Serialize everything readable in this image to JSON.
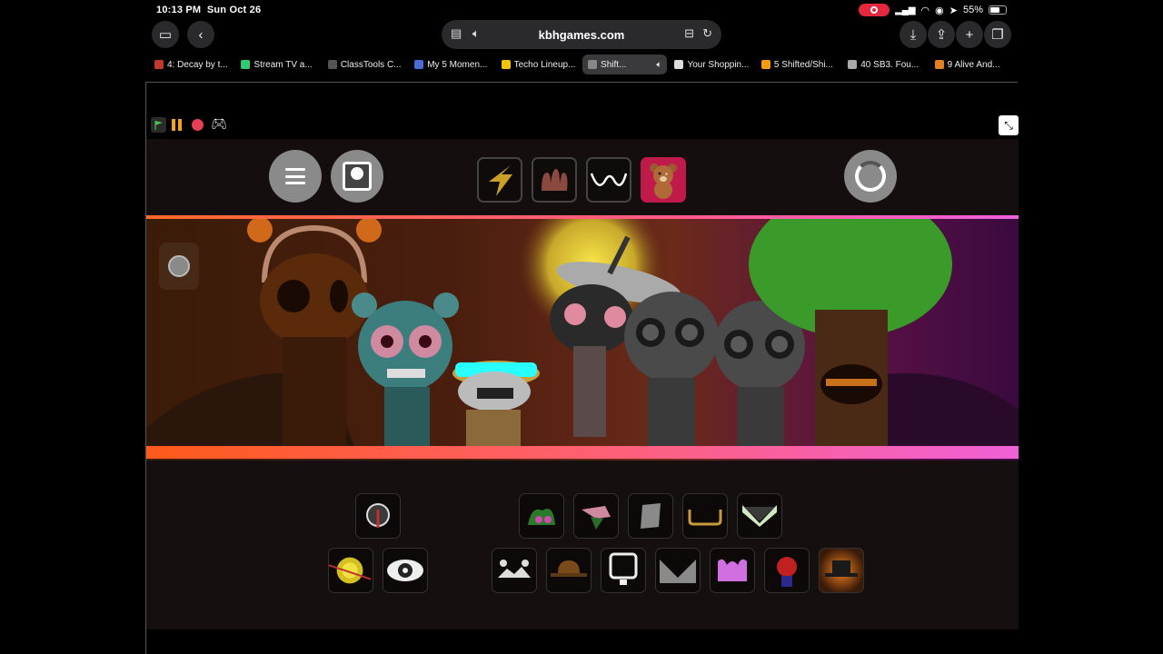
{
  "status": {
    "time": "10:13 PM",
    "date": "Sun Oct 26",
    "battery": "55%"
  },
  "browser": {
    "url": "kbhgames.com",
    "tabs": [
      {
        "label": "4: Decay by t...",
        "color": "#c0392b",
        "icon": "music-icon"
      },
      {
        "label": "Stream TV a...",
        "color": "#2ecc71",
        "icon": "h-icon"
      },
      {
        "label": "ClassTools C...",
        "color": "#555555",
        "icon": "c-icon"
      },
      {
        "label": "My 5 Momen...",
        "color": "#4a6cd4",
        "icon": "globe-icon"
      },
      {
        "label": "Techo Lineup...",
        "color": "#f1c40f",
        "icon": "doc-icon"
      },
      {
        "label": "Shift...",
        "color": "#888888",
        "icon": "close-icon",
        "active": true
      },
      {
        "label": "Your Shoppin...",
        "color": "#dddddd",
        "icon": "page-icon"
      },
      {
        "label": "5 Shifted/Shi...",
        "color": "#f39c12",
        "icon": "kbh-icon"
      },
      {
        "label": "40 SB3. Fou...",
        "color": "#aaaaaa",
        "icon": "page-icon"
      },
      {
        "label": "9 Alive And...",
        "color": "#e67e22",
        "icon": "face-icon"
      }
    ]
  },
  "game": {
    "top_modes": [
      "bolt-mode",
      "hands-mode",
      "wave-mode",
      "bear-mode"
    ],
    "active_mode": "bear-mode"
  }
}
